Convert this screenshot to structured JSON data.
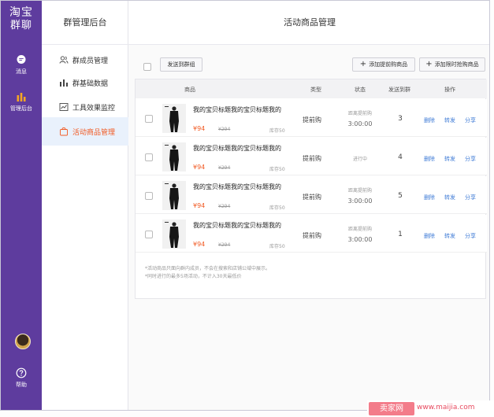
{
  "rail": {
    "logo_line1": "淘宝",
    "logo_line2": "群聊",
    "messages_label": "消息",
    "admin_label": "管理后台",
    "help_label": "帮助",
    "messages_icon": "chat-bubble-icon",
    "admin_icon": "bar-chart-icon",
    "help_icon": "question-circle-icon",
    "bg_color": "#5e3c9e"
  },
  "subnav": {
    "title": "群管理后台",
    "items": [
      {
        "label": "群成员管理",
        "icon": "users-icon"
      },
      {
        "label": "群基础数据",
        "icon": "bar-chart-icon"
      },
      {
        "label": "工具效果监控",
        "icon": "line-chart-icon"
      },
      {
        "label": "活动商品管理",
        "icon": "bag-icon"
      }
    ],
    "active_index": 3,
    "active_color": "#f15a23"
  },
  "main": {
    "title": "活动商品管理",
    "toolbar": {
      "send_to_group": "发送到群组",
      "add_pre_purchase": "添加提前购商品",
      "add_limited_purchase": "添加限时抢购商品"
    },
    "columns": {
      "product": "商品",
      "type": "类型",
      "status": "状态",
      "sent_to_group": "发送到群",
      "actions": "操作"
    },
    "rows": [
      {
        "name": "我的宝贝标题我的宝贝标题我的",
        "price": "¥94",
        "old_price": "¥294",
        "stock": "库存50",
        "type": "提前购",
        "status_line1": "距离提前购",
        "status_line2": "3:00:00",
        "count": "3"
      },
      {
        "name": "我的宝贝标题我的宝贝标题我的",
        "price": "¥94",
        "old_price": "¥294",
        "stock": "库存50",
        "type": "提前购",
        "status_line1": "进行中",
        "status_line2": "",
        "count": "4"
      },
      {
        "name": "我的宝贝标题我的宝贝标题我的",
        "price": "¥94",
        "old_price": "¥294",
        "stock": "库存50",
        "type": "提前购",
        "status_line1": "距离提前购",
        "status_line2": "3:00:00",
        "count": "5"
      },
      {
        "name": "我的宝贝标题我的宝贝标题我的",
        "price": "¥94",
        "old_price": "¥294",
        "stock": "库存50",
        "type": "提前购",
        "status_line1": "距离提前购",
        "status_line2": "3:00:00",
        "count": "1"
      }
    ],
    "actions": {
      "delete": "删除",
      "forward": "转发",
      "share": "分享"
    },
    "notes": [
      "*活动商品只面向群内成员，不会在搜索和店铺公域中展示。",
      "*同时进行的最多5场活动，不计入30天最低价"
    ]
  },
  "watermark": {
    "logo": "卖家网",
    "url": "www.maijia.com"
  }
}
